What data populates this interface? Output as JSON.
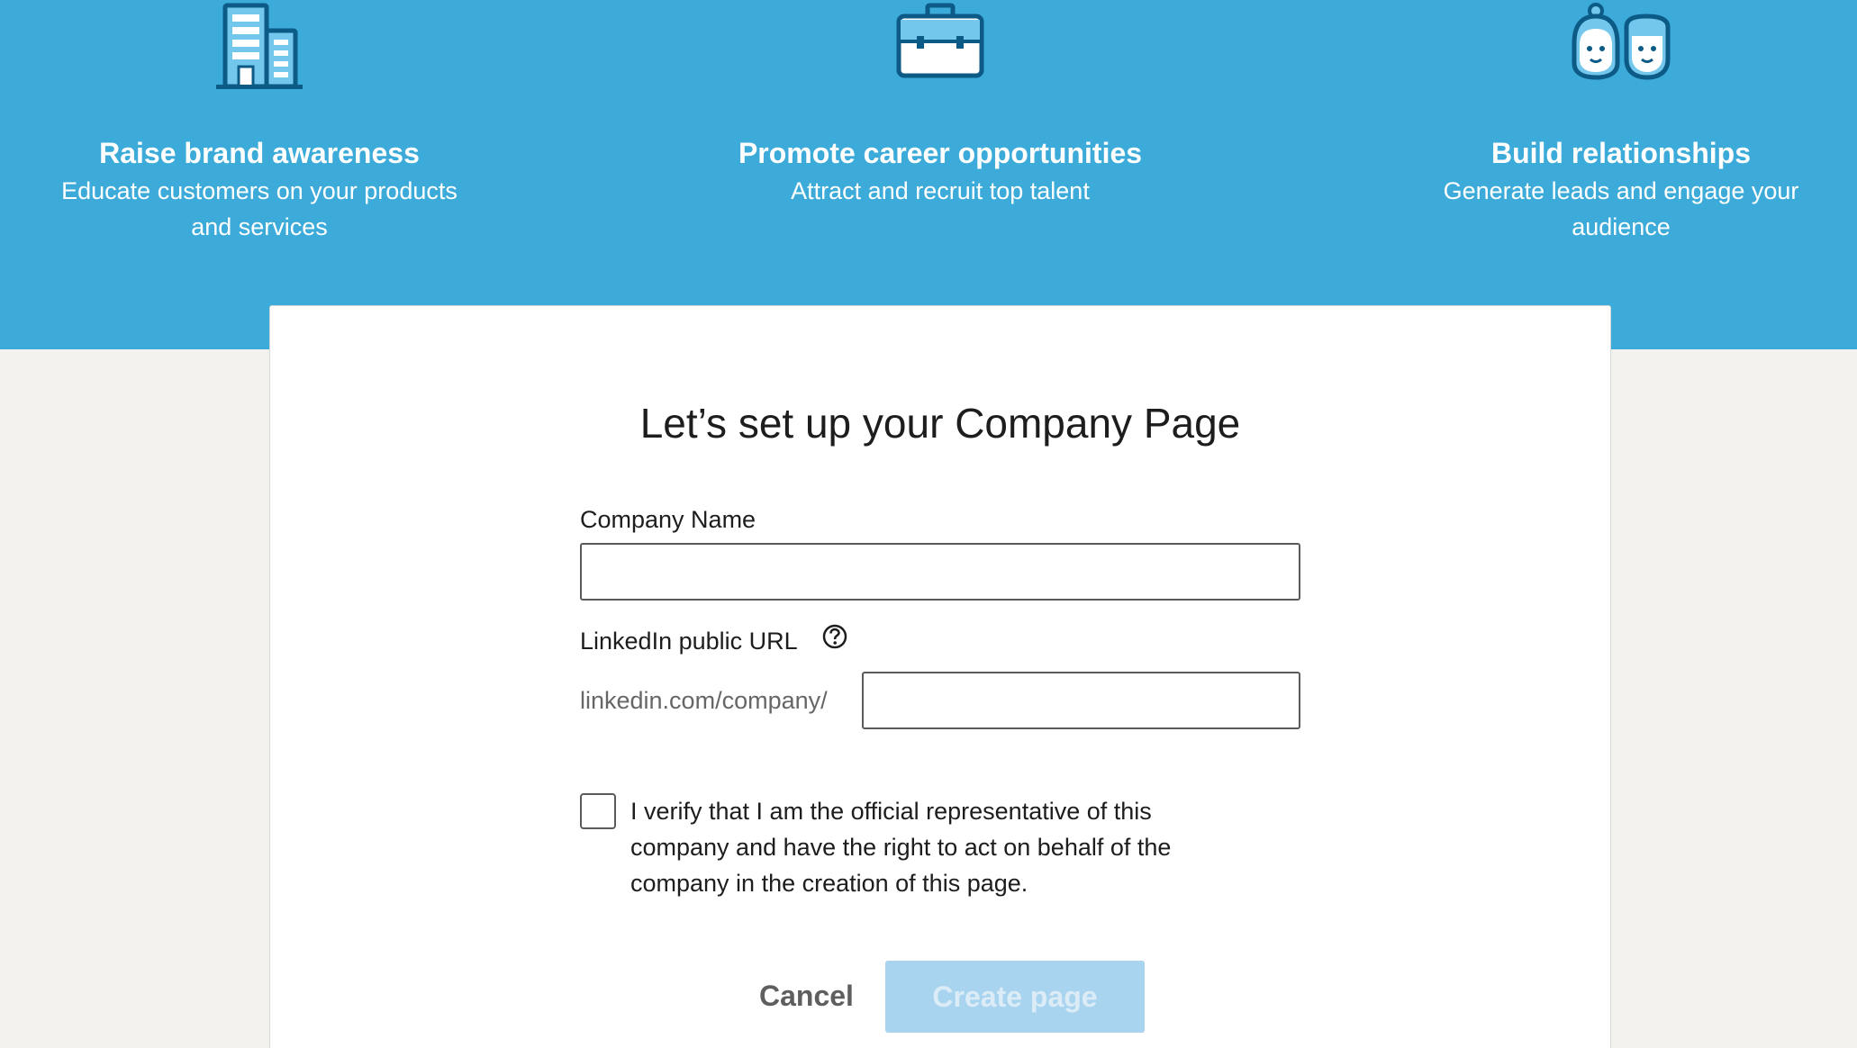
{
  "colors": {
    "banner": "#3dabd9",
    "icon_dark": "#0c5a86",
    "icon_light": "#74c7ec",
    "background": "#f3f2ef",
    "button_disabled": "#a8d4ef"
  },
  "features": [
    {
      "icon": "building-icon",
      "title": "Raise brand awareness",
      "desc_line1": "Educate customers on your products",
      "desc_line2": "and services"
    },
    {
      "icon": "briefcase-icon",
      "title": "Promote career opportunities",
      "desc_line1": "Attract and recruit top talent",
      "desc_line2": ""
    },
    {
      "icon": "people-icon",
      "title": "Build relationships",
      "desc_line1": "Generate leads and engage your",
      "desc_line2": "audience"
    }
  ],
  "form": {
    "heading": "Let’s set up your Company Page",
    "company_name_label": "Company Name",
    "company_name_value": "",
    "url_label": "LinkedIn public URL",
    "help_icon": "question-circle-icon",
    "url_prefix": "linkedin.com/company/",
    "url_value": "",
    "verify_line1": "I verify that I am the official representative of this",
    "verify_line2": "company and have the right to act on behalf of the",
    "verify_line3": "company in the creation of this page.",
    "verify_checked": false,
    "cancel_label": "Cancel",
    "create_label": "Create page"
  }
}
